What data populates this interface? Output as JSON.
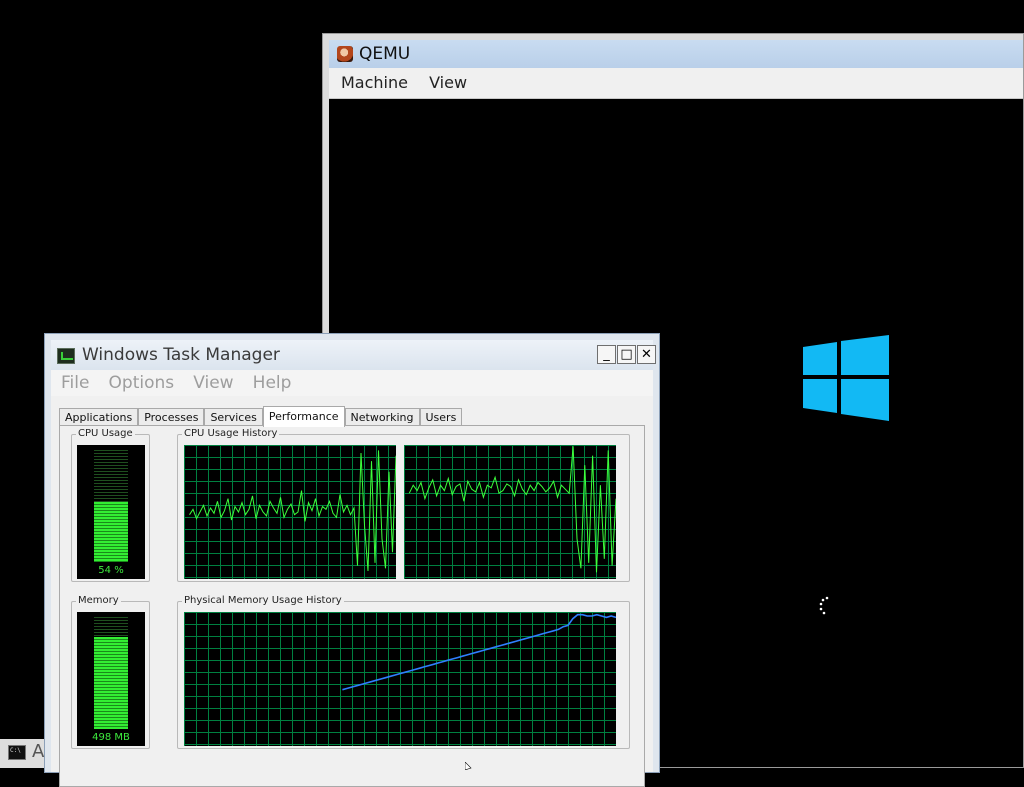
{
  "qemu": {
    "title": "QEMU",
    "menu": [
      "Machine",
      "View"
    ]
  },
  "task_manager": {
    "title": "Windows Task Manager",
    "caption_buttons": {
      "minimize": "_",
      "maximize": "□",
      "close": "✕"
    },
    "menu": [
      "File",
      "Options",
      "View",
      "Help"
    ],
    "tabs": [
      "Applications",
      "Processes",
      "Services",
      "Performance",
      "Networking",
      "Users"
    ],
    "active_tab": "Performance",
    "cpu_usage": {
      "label": "CPU Usage",
      "value_text": "54 %",
      "level": 0.54
    },
    "cpu_history": {
      "label": "CPU Usage History"
    },
    "memory": {
      "label": "Memory",
      "value_text": "498 MB",
      "level": 0.82
    },
    "memory_history": {
      "label": "Physical Memory Usage History"
    }
  },
  "chart_data": [
    {
      "type": "line",
      "title": "CPU Usage History",
      "series": [
        {
          "values": [
            48,
            52,
            45,
            50,
            55,
            47,
            53,
            49,
            58,
            46,
            51,
            60,
            44,
            54,
            50,
            57,
            48,
            52,
            62,
            45,
            55,
            50,
            47,
            58,
            53,
            49,
            61,
            46,
            52,
            56,
            48,
            50,
            66,
            43,
            57,
            51,
            60,
            47,
            54,
            52,
            58,
            49,
            46,
            63,
            50,
            55,
            48,
            53,
            10,
            94,
            40,
            6,
            88,
            12,
            96,
            30,
            8,
            80,
            20,
            92
          ]
        },
        {
          "values": [
            64,
            70,
            66,
            72,
            60,
            68,
            74,
            62,
            70,
            66,
            75,
            63,
            69,
            71,
            58,
            73,
            67,
            65,
            72,
            61,
            70,
            68,
            76,
            64,
            66,
            71,
            69,
            62,
            74,
            67,
            63,
            70,
            66,
            72,
            69,
            65,
            68,
            73,
            61,
            70,
            67,
            64,
            99,
            30,
            8,
            85,
            12,
            92,
            5,
            70,
            15,
            96,
            10,
            60
          ]
        }
      ],
      "ylim": [
        0,
        100
      ]
    },
    {
      "type": "line",
      "title": "Physical Memory Usage History",
      "series": [
        {
          "values": [
            42,
            43,
            44,
            45,
            46,
            47,
            48,
            49,
            50,
            51,
            52,
            53,
            54,
            55,
            56,
            57,
            58,
            59,
            60,
            61,
            62,
            63,
            64,
            65,
            66,
            67,
            68,
            69,
            70,
            71,
            72,
            73,
            74,
            75,
            76,
            77,
            78,
            79,
            80,
            81,
            82,
            83,
            84,
            85,
            86,
            87,
            89,
            90,
            95,
            98,
            98,
            97,
            97,
            98,
            97,
            96,
            97,
            96
          ]
        }
      ],
      "ylim": [
        0,
        100
      ]
    }
  ],
  "taskbar": {
    "label": "A"
  }
}
